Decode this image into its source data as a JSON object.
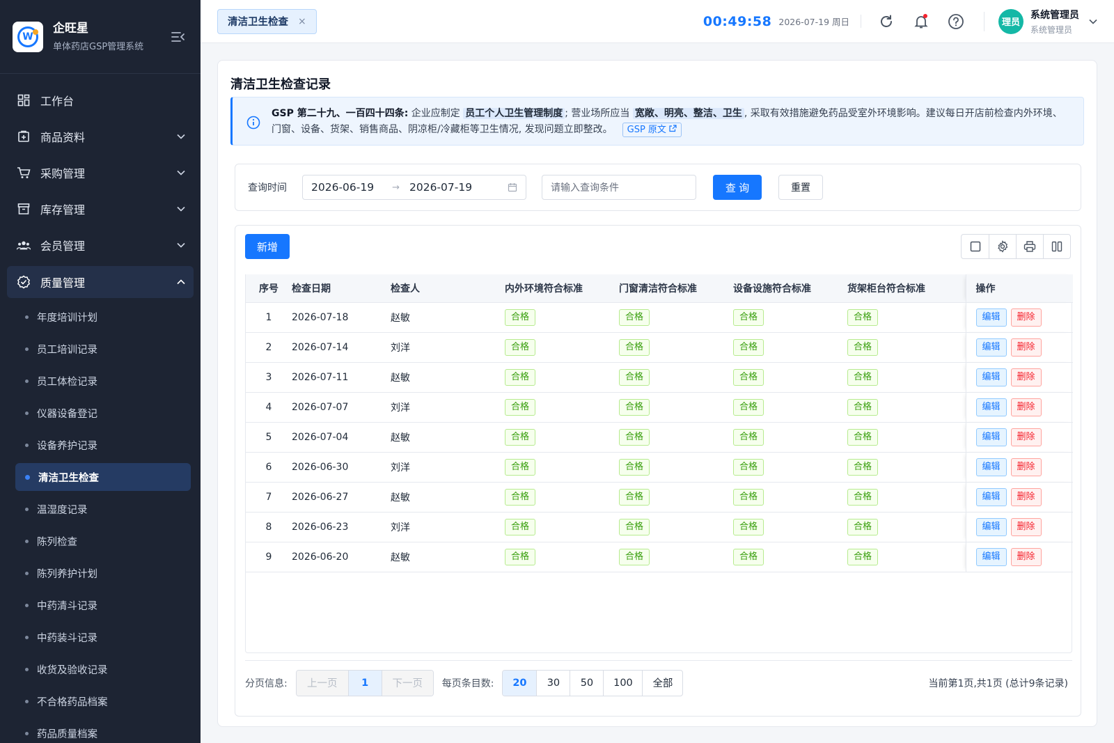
{
  "brand": {
    "name": "企旺星",
    "subtitle": "单体药店GSP管理系统",
    "logo_letter": "W"
  },
  "menu": [
    {
      "label": "工作台",
      "icon": "dashboard-icon"
    },
    {
      "label": "商品资料",
      "icon": "product-icon"
    },
    {
      "label": "采购管理",
      "icon": "cart-icon"
    },
    {
      "label": "库存管理",
      "icon": "inventory-icon"
    },
    {
      "label": "会员管理",
      "icon": "members-icon"
    },
    {
      "label": "质量管理",
      "icon": "quality-icon"
    }
  ],
  "submenu": [
    "年度培训计划",
    "员工培训记录",
    "员工体检记录",
    "仪器设备登记",
    "设备养护记录",
    "清洁卫生检查",
    "温湿度记录",
    "陈列检查",
    "陈列养护计划",
    "中药清斗记录",
    "中药装斗记录",
    "收货及验收记录",
    "不合格药品档案",
    "药品质量档案"
  ],
  "active_submenu": "清洁卫生检查",
  "topbar": {
    "tab_label": "清洁卫生检查",
    "tab_close": "×",
    "clock": "00:49:58",
    "date": "2026-07-19 周日",
    "user_avatar": "理员",
    "user_name": "系统管理员",
    "user_role": "系统管理员"
  },
  "page": {
    "title": "清洁卫生检查记录",
    "notice": {
      "lead": "GSP 第二十九、一百四十四条:",
      "t1": " 企业应制定 ",
      "h1": "员工个人卫生管理制度",
      "t2": "; 营业场所应当 ",
      "h2": "宽敞、明亮、整洁、卫生",
      "t3": ", 采取有效措施避免药品受室外环境影响。建议每日开店前检查内外环境、门窗、设备、货架、销售商品、阴凉柜/冷藏柜等卫生情况, 发现问题立即整改。",
      "link": "GSP 原文"
    }
  },
  "filter": {
    "label": "查询时间",
    "start": "2026-06-19",
    "arrow": "→",
    "end": "2026-07-19",
    "placeholder": "请输入查询条件",
    "query_label": "查 询",
    "reset_label": "重置"
  },
  "toolbar": {
    "add_label": "新增"
  },
  "table": {
    "columns": [
      "序号",
      "检查日期",
      "检查人",
      "内外环境符合标准",
      "门窗清洁符合标准",
      "设备设施符合标准",
      "货架柜台符合标准",
      "操作"
    ],
    "edit_label": "编辑",
    "delete_label": "删除",
    "rows": [
      {
        "idx": "1",
        "date": "2026-07-18",
        "inspector": "赵敏",
        "env": "合格",
        "door": "合格",
        "equip": "合格",
        "shelf": "合格"
      },
      {
        "idx": "2",
        "date": "2026-07-14",
        "inspector": "刘洋",
        "env": "合格",
        "door": "合格",
        "equip": "合格",
        "shelf": "合格"
      },
      {
        "idx": "3",
        "date": "2026-07-11",
        "inspector": "赵敏",
        "env": "合格",
        "door": "合格",
        "equip": "合格",
        "shelf": "合格"
      },
      {
        "idx": "4",
        "date": "2026-07-07",
        "inspector": "刘洋",
        "env": "合格",
        "door": "合格",
        "equip": "合格",
        "shelf": "合格"
      },
      {
        "idx": "5",
        "date": "2026-07-04",
        "inspector": "赵敏",
        "env": "合格",
        "door": "合格",
        "equip": "合格",
        "shelf": "合格"
      },
      {
        "idx": "6",
        "date": "2026-06-30",
        "inspector": "刘洋",
        "env": "合格",
        "door": "合格",
        "equip": "合格",
        "shelf": "合格"
      },
      {
        "idx": "7",
        "date": "2026-06-27",
        "inspector": "赵敏",
        "env": "合格",
        "door": "合格",
        "equip": "合格",
        "shelf": "合格"
      },
      {
        "idx": "8",
        "date": "2026-06-23",
        "inspector": "刘洋",
        "env": "合格",
        "door": "合格",
        "equip": "合格",
        "shelf": "合格"
      },
      {
        "idx": "9",
        "date": "2026-06-20",
        "inspector": "赵敏",
        "env": "合格",
        "door": "合格",
        "equip": "合格",
        "shelf": "合格"
      }
    ]
  },
  "pagination": {
    "label": "分页信息:",
    "prev": "上一页",
    "current": "1",
    "next": "下一页",
    "size_label": "每页条目数:",
    "sizes": [
      "20",
      "30",
      "50",
      "100",
      "全部"
    ],
    "selected_size": "20",
    "summary": "当前第1页,共1页 (总计9条记录)"
  },
  "colors": {
    "primary": "#1677ff",
    "sidebar_bg": "#1d2433",
    "ok_green": "#389e0d",
    "danger": "#f5222d"
  }
}
